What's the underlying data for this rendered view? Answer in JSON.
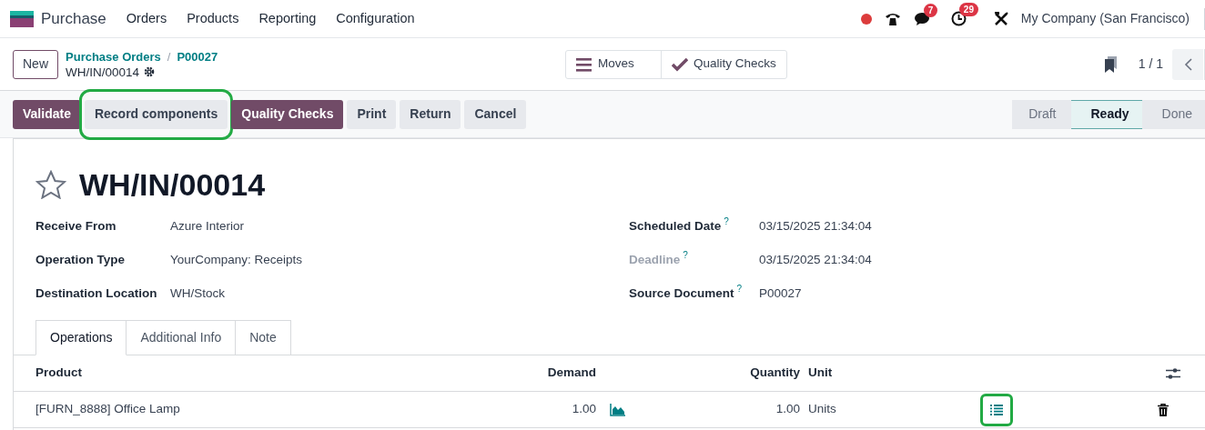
{
  "navbar": {
    "app_name": "Purchase",
    "menu": [
      "Orders",
      "Products",
      "Reporting",
      "Configuration"
    ],
    "messages_badge": "7",
    "activities_badge": "29",
    "company": "My Company (San Francisco)"
  },
  "control_panel": {
    "new_button": "New",
    "breadcrumbs": [
      "Purchase Orders",
      "P00027"
    ],
    "breadcrumb_separator": "/",
    "record_name": "WH/IN/00014",
    "smart_buttons": [
      {
        "kind": "list",
        "label": "Moves"
      },
      {
        "kind": "check",
        "label": "Quality Checks"
      }
    ],
    "pager": "1 / 1"
  },
  "actions": [
    {
      "label": "Validate",
      "primary": true,
      "highlighted": false
    },
    {
      "label": "Record components",
      "primary": false,
      "highlighted": true
    },
    {
      "label": "Quality Checks",
      "primary": true,
      "highlighted": false
    },
    {
      "label": "Print",
      "primary": false,
      "highlighted": false
    },
    {
      "label": "Return",
      "primary": false,
      "highlighted": false
    },
    {
      "label": "Cancel",
      "primary": false,
      "highlighted": false
    }
  ],
  "statusbar": [
    {
      "label": "Draft",
      "selected": false
    },
    {
      "label": "Ready",
      "selected": true
    },
    {
      "label": "Done",
      "selected": false
    }
  ],
  "form": {
    "title": "WH/IN/00014",
    "starred": false,
    "left_fields": [
      {
        "label": "Receive From",
        "value": "Azure Interior"
      },
      {
        "label": "Operation Type",
        "value": "YourCompany: Receipts"
      },
      {
        "label": "Destination Location",
        "value": "WH/Stock"
      }
    ],
    "right_fields": [
      {
        "label": "Scheduled Date",
        "help": "?",
        "muted": false,
        "value": "03/15/2025 21:34:04"
      },
      {
        "label": "Deadline",
        "help": "?",
        "muted": true,
        "value": "03/15/2025 21:34:04"
      },
      {
        "label": "Source Document",
        "help": "?",
        "muted": false,
        "value": "P00027"
      }
    ],
    "tabs": [
      {
        "label": "Operations",
        "selected": true
      },
      {
        "label": "Additional Info",
        "selected": false
      },
      {
        "label": "Note",
        "selected": false
      }
    ],
    "table": {
      "columns": [
        "Product",
        "Demand",
        "Quantity",
        "Unit"
      ],
      "rows": [
        {
          "product": "[FURN_8888] Office Lamp",
          "demand": "1.00",
          "quantity": "1.00",
          "unit": "Units",
          "details_highlighted": true
        }
      ]
    }
  }
}
